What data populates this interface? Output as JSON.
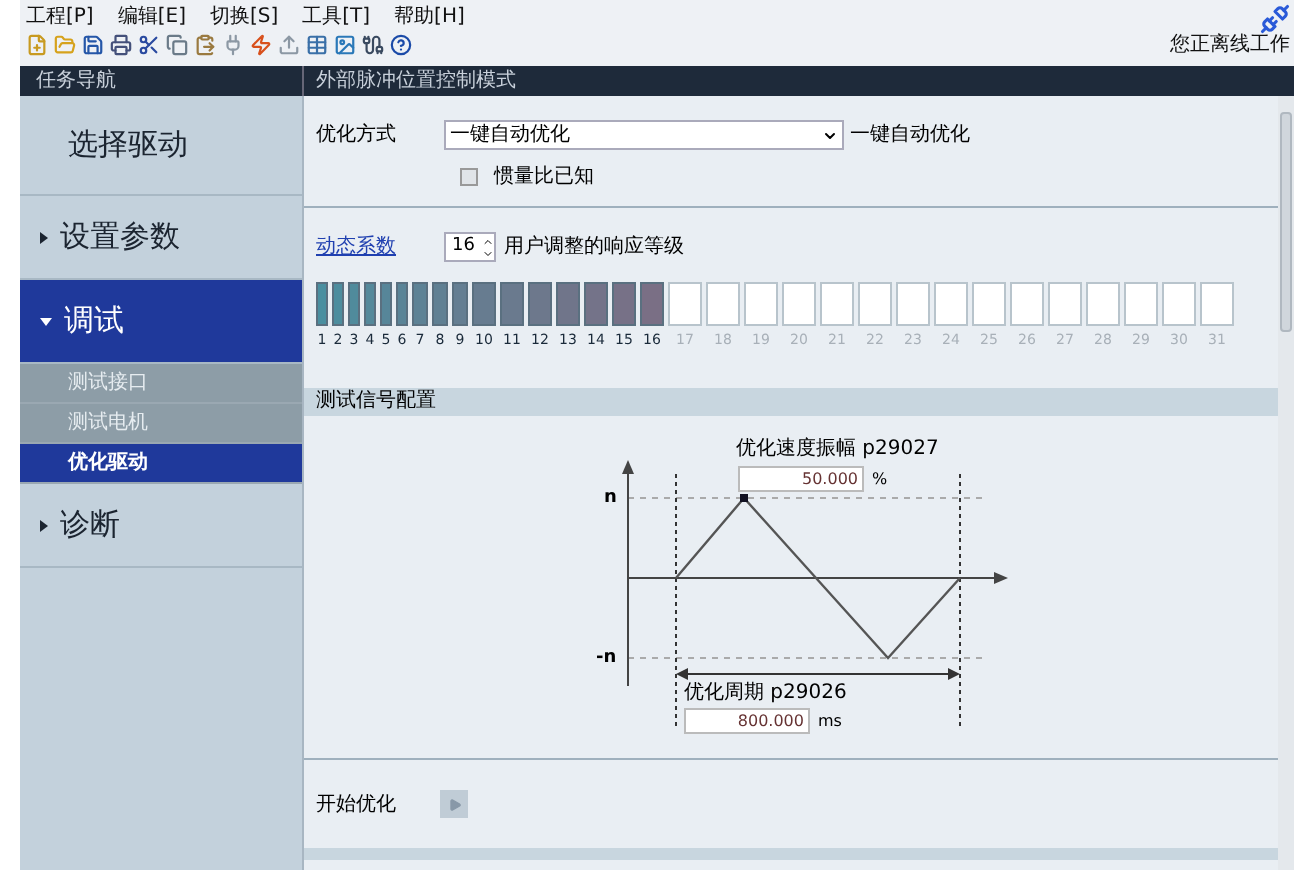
{
  "menu": [
    "工程[P]",
    "编辑[E]",
    "切换[S]",
    "工具[T]",
    "帮助[H]"
  ],
  "status": {
    "text": "您正离线工作"
  },
  "nav_header": "任务导航",
  "page_header": "外部脉冲位置控制模式",
  "sidebar": {
    "items": [
      {
        "label": "选择驱动",
        "kind": "plain",
        "selected": false
      },
      {
        "label": "设置参数",
        "kind": "group",
        "expanded": false,
        "selected": false
      },
      {
        "label": "调试",
        "kind": "group",
        "expanded": true,
        "selected": true,
        "children": [
          {
            "label": "测试接口",
            "selected": false
          },
          {
            "label": "测试电机",
            "selected": false
          },
          {
            "label": "优化驱动",
            "selected": true
          }
        ]
      },
      {
        "label": "诊断",
        "kind": "group",
        "expanded": false,
        "selected": false
      }
    ]
  },
  "optimization": {
    "label": "优化方式",
    "value": "一键自动优化",
    "note": "一键自动优化",
    "checkbox": {
      "label": "惯量比已知",
      "checked": false
    }
  },
  "dynamics": {
    "link": "动态系数",
    "value": "16",
    "note": "用户调整的响应等级",
    "segments": [
      {
        "label": "1",
        "filled": true
      },
      {
        "label": "2",
        "filled": true
      },
      {
        "label": "3",
        "filled": true
      },
      {
        "label": "4",
        "filled": true
      },
      {
        "label": "5",
        "filled": true
      },
      {
        "label": "6",
        "filled": true
      },
      {
        "label": "7",
        "filled": true
      },
      {
        "label": "8",
        "filled": true
      },
      {
        "label": "9",
        "filled": true
      },
      {
        "label": "10",
        "filled": true
      },
      {
        "label": "11",
        "filled": true
      },
      {
        "label": "12",
        "filled": true
      },
      {
        "label": "13",
        "filled": true
      },
      {
        "label": "14",
        "filled": true
      },
      {
        "label": "15",
        "filled": true
      },
      {
        "label": "16",
        "filled": true
      },
      {
        "label": "17",
        "filled": false
      },
      {
        "label": "18",
        "filled": false
      },
      {
        "label": "19",
        "filled": false
      },
      {
        "label": "20",
        "filled": false
      },
      {
        "label": "21",
        "filled": false
      },
      {
        "label": "22",
        "filled": false
      },
      {
        "label": "23",
        "filled": false
      },
      {
        "label": "24",
        "filled": false
      },
      {
        "label": "25",
        "filled": false
      },
      {
        "label": "26",
        "filled": false
      },
      {
        "label": "27",
        "filled": false
      },
      {
        "label": "28",
        "filled": false
      },
      {
        "label": "29",
        "filled": false
      },
      {
        "label": "30",
        "filled": false
      },
      {
        "label": "31",
        "filled": false
      }
    ]
  },
  "signal_config": {
    "title": "测试信号配置",
    "diagram": {
      "amplitude_label": "优化速度振幅 p29027",
      "amplitude_value": "50.000",
      "amplitude_unit": "%",
      "y_max": "n",
      "y_min": "-n",
      "period_label": "优化周期 p29026",
      "period_value": "800.000",
      "period_unit": "ms"
    }
  },
  "start": {
    "label": "开始优化"
  }
}
